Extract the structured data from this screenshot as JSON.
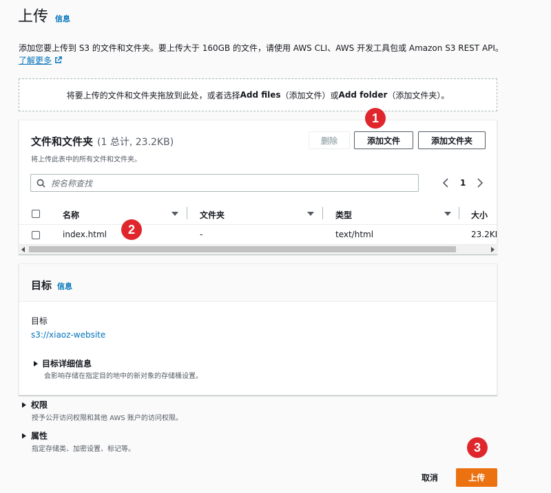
{
  "header": {
    "title": "上传",
    "info_link": "信息",
    "description": "添加您要上传到 S3 的文件和文件夹。要上传大于 160GB 的文件，请使用 AWS CLI、AWS 开发工具包或 Amazon S3 REST API。",
    "learn_more": "了解更多"
  },
  "dropzone": {
    "text_prefix": "将要上传的文件和文件夹拖放到此处，或者选择 ",
    "add_files": "Add files",
    "text_mid": "（添加文件）或 ",
    "add_folder": "Add folder",
    "text_suffix": "（添加文件夹）。"
  },
  "files_panel": {
    "title": "文件和文件夹",
    "count": "(1 总计, 23.2KB)",
    "subtitle": "将上传此表中的所有文件和文件夹。",
    "delete_label": "删除",
    "add_files_label": "添加文件",
    "add_folder_label": "添加文件夹",
    "search_placeholder": "按名称查找",
    "page_number": "1",
    "columns": [
      "名称",
      "文件夹",
      "类型",
      "大小"
    ],
    "rows": [
      {
        "name": "index.html",
        "folder": "-",
        "type": "text/html",
        "size": "23.2KB"
      }
    ]
  },
  "destination": {
    "title": "目标",
    "info_link": "信息",
    "label": "目标",
    "value": "s3://xiaoz-website",
    "details_title": "目标详细信息",
    "details_desc": "会影响存储在指定目的地中的新对象的存储桶设置。"
  },
  "permissions": {
    "title": "权限",
    "desc": "授予公开访问权限和其他 AWS 账户的访问权限。"
  },
  "properties": {
    "title": "属性",
    "desc": "指定存储类、加密设置、标记等。"
  },
  "footer": {
    "cancel_label": "取消",
    "upload_label": "上传"
  },
  "annotations": [
    "1",
    "2",
    "3"
  ],
  "colors": {
    "link": "#0073bb",
    "primary": "#ec7211",
    "badge": "#e0262d"
  }
}
